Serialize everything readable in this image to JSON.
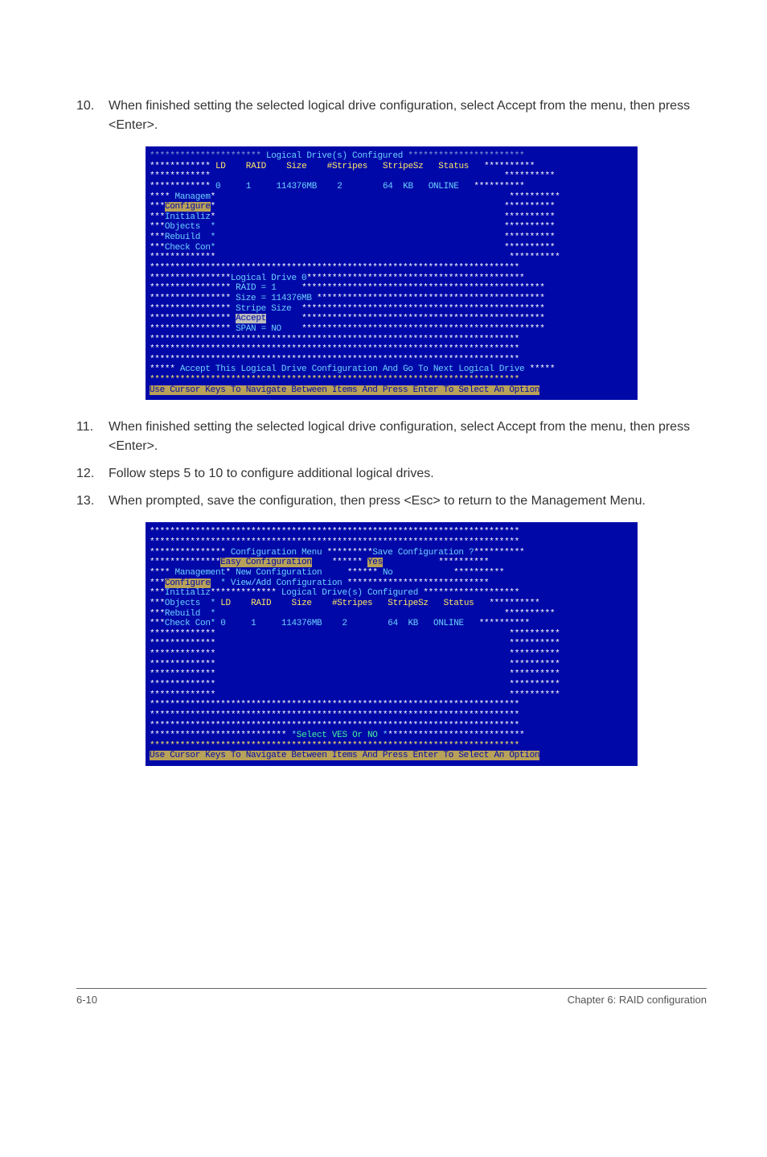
{
  "steps": {
    "s10": {
      "num": "10.",
      "text": "When finished setting the selected logical drive configuration, select Accept from the menu, then press <Enter>."
    },
    "s11": {
      "num": "11.",
      "text": "When finished setting the selected logical drive configuration, select Accept from the menu, then press <Enter>."
    },
    "s12": {
      "num": "12.",
      "text": "Follow steps 5 to 10 to configure additional logical drives."
    },
    "s13": {
      "num": "13.",
      "text": "When prompted, save the configuration, then press <Esc> to return to the Management Menu."
    }
  },
  "terminal1": {
    "header_title": "Logical Drive(s) Configured",
    "cols": {
      "c1": "LD",
      "c2": "RAID",
      "c3": "Size",
      "c4": "#Stripes",
      "c5": "StripeSz",
      "c6": "Status"
    },
    "row": {
      "ld": "0",
      "raid": "1",
      "size": "114376MB",
      "stripes": "2",
      "stripesz": "64",
      "mb": "KB",
      "status": "ONLINE"
    },
    "menu": {
      "m1": "Managem",
      "m2": "Configure",
      "m3": "Initializ",
      "m4": "Objects",
      "m5": "Rebuild",
      "m6": "Check Con"
    },
    "ld_box": {
      "title": "Logical Drive 0",
      "l1": "RAID = 1",
      "l2": "Size = 114376MB",
      "l3": "Stripe Size",
      "l4": "Accept",
      "l5": "SPAN = NO"
    },
    "msg": "Accept This Logical Drive Configuration And Go To Next Logical Drive",
    "hint": "Use Cursor Keys To Navigate Between Items And Press Enter To Select An Option"
  },
  "terminal2": {
    "conf_menu_title": "Configuration Menu",
    "save_title": "Save Configuration ?",
    "easy": "Easy Configuration",
    "yes": "Yes",
    "newc": "New Configuration",
    "no": "No",
    "view": "View/Add Configuration",
    "menu": {
      "m1": "Management",
      "m2": "Configure",
      "m3": "Initializ",
      "m4": "Objects",
      "m5": "Rebuild",
      "m6": "Check Con"
    },
    "header_title": "Logical Drive(s) Configured",
    "cols": {
      "c1": "LD",
      "c2": "RAID",
      "c3": "Size",
      "c4": "#Stripes",
      "c5": "StripeSz",
      "c6": "Status"
    },
    "row": {
      "ld": "0",
      "raid": "1",
      "size": "114376MB",
      "stripes": "2",
      "stripesz": "64",
      "mb": "KB",
      "status": "ONLINE"
    },
    "prompt": "Select VES Or NO",
    "hint": "Use Cursor Keys To Navigate Between Items And Press Enter To Select An Option"
  },
  "footer": {
    "left": "6-10",
    "right": "Chapter 6: RAID configuration"
  }
}
